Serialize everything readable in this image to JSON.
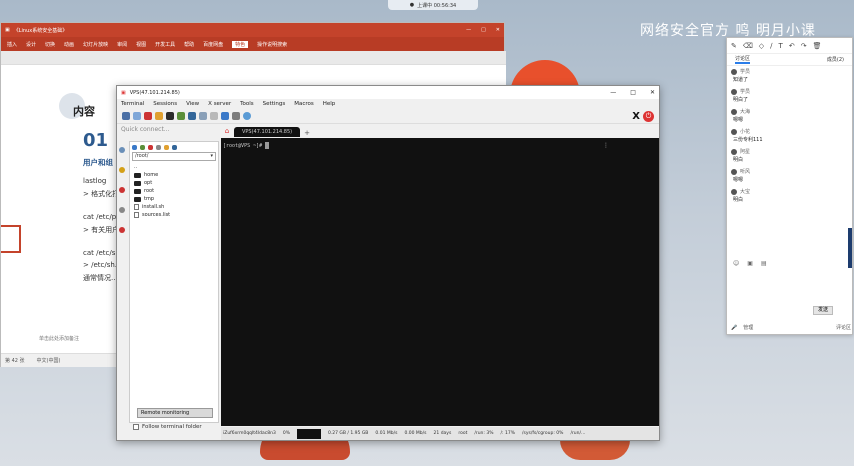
{
  "top_bar": {
    "label": "上课中 00:56:34"
  },
  "watermark": "网络安全官方 鸣 明月小课",
  "powerpoint": {
    "doc_title": "《Linux系统安全基础》",
    "window_controls": [
      "—",
      "□",
      "✕"
    ],
    "ribbon": [
      "插入",
      "设计",
      "切换",
      "动画",
      "幻灯片放映",
      "审阅",
      "视图",
      "开发工具",
      "帮助",
      "百度网盘",
      "特色",
      "操作说明搜索"
    ],
    "ribbon_active": "特色",
    "slide": {
      "title": "内容",
      "number": "01",
      "heading": "用户和组",
      "lines": [
        "lastlog",
        "> 格式化打...",
        "cat /etc/p...",
        "> 有关用户...",
        "cat /etc/s...",
        "> /etc/sh...",
        "通常情况..."
      ]
    },
    "notes_placeholder": "单击此处添加备注",
    "status": [
      "第 42 张",
      "中文(中国)"
    ]
  },
  "mobaxterm": {
    "title": "VPS(47.101.214.85)",
    "window_controls": [
      "—",
      "□",
      "✕"
    ],
    "menu": [
      "Terminal",
      "Sessions",
      "View",
      "X server",
      "Tools",
      "Settings",
      "Macros",
      "Help"
    ],
    "quick_connect_placeholder": "Quick connect...",
    "tab_label": "VPS(47.101.214.85)",
    "path": "/root/",
    "tree": [
      {
        "name": "..",
        "type": "up"
      },
      {
        "name": "home",
        "type": "folder"
      },
      {
        "name": "opt",
        "type": "folder"
      },
      {
        "name": "root",
        "type": "folder"
      },
      {
        "name": "tmp",
        "type": "folder"
      },
      {
        "name": "install.sh",
        "type": "file"
      },
      {
        "name": "sources.list",
        "type": "file"
      }
    ],
    "remote_monitoring": "Remote monitoring",
    "follow_terminal": "Follow terminal folder",
    "prompt": "[root@VPS ~]#",
    "statusbar": [
      "iZuf6xrm0qqlt4ldac8n3",
      "0%",
      "0.27 GB / 1.95 GB",
      "0.01 Mb/s",
      "0.00 Mb/s",
      "21 days",
      "root",
      "/run: 3%",
      "/: 17%",
      "/sys/fs/cgroup: 0%",
      "/run/..."
    ]
  },
  "chat": {
    "tabs": [
      "讨论区",
      "成员(2)"
    ],
    "messages": [
      {
        "user": "学员",
        "text": "知道了"
      },
      {
        "user": "学员",
        "text": "明白了"
      },
      {
        "user": "大海",
        "text": "嗯嗯"
      },
      {
        "user": "小花",
        "text": "三份专利111"
      },
      {
        "user": "阿星",
        "text": "明白"
      },
      {
        "user": "听风",
        "text": "嗯嗯"
      },
      {
        "user": "大宝",
        "text": "明白"
      }
    ],
    "send": "发送",
    "bottom": [
      "管理",
      "评论区"
    ]
  }
}
